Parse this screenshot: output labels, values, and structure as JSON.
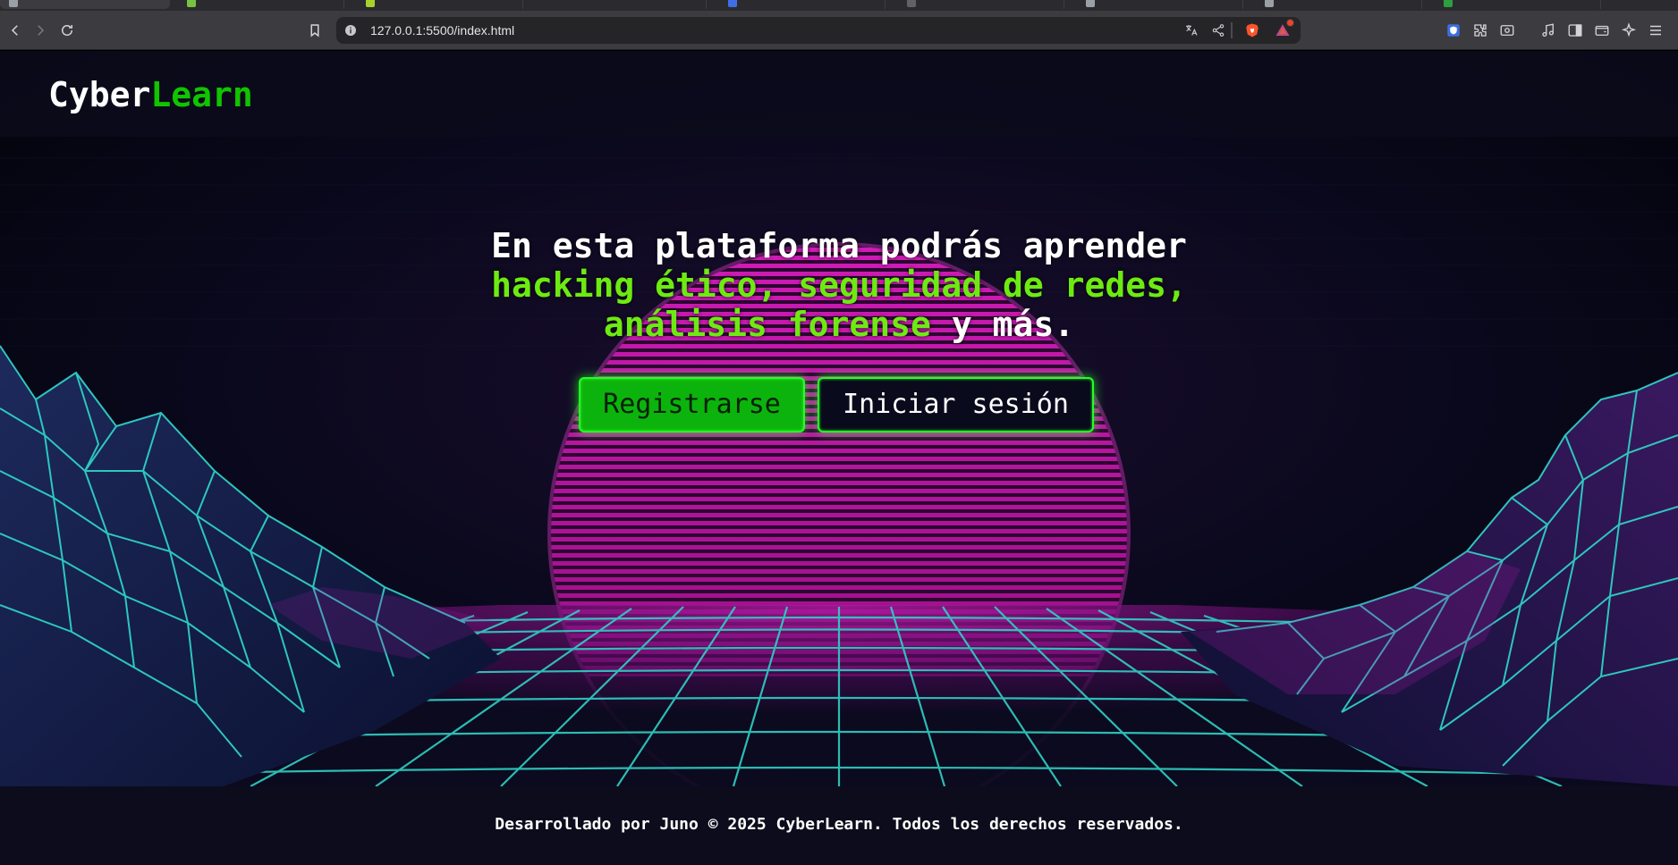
{
  "browser": {
    "url": "127.0.0.1:5500/index.html",
    "tab_favicon_colors": [
      "#9aa0a6",
      "#7ac142",
      "#a8d12a",
      "#3f6ee8",
      "#9aa0a6",
      "#9aa0a6",
      "#9aa0a6",
      "#2e9e3f"
    ],
    "icons": {
      "back": "arrow-left-icon",
      "forward": "arrow-right-icon",
      "reload": "reload-icon",
      "bookmark": "bookmark-icon",
      "site_info": "info-icon",
      "translate": "translate-icon",
      "share": "share-icon",
      "brave_shield": "brave-lion-icon",
      "rewards": "triangle-rewards-icon",
      "extension_1": "shield-extension-icon",
      "extensions": "puzzle-icon",
      "screenshot": "screenshot-icon",
      "media": "music-note-icon",
      "sidebar": "sidebar-icon",
      "wallet": "wallet-icon",
      "leo": "sparkle-icon",
      "menu": "hamburger-menu-icon"
    }
  },
  "site": {
    "logo_part1": "Cyber",
    "logo_part2": "Learn",
    "headline": {
      "line1": "En esta plataforma podrás aprender",
      "highlight1": "hacking ético, seguridad de redes,",
      "highlight2": "análisis forense",
      "tail": " y más."
    },
    "buttons": {
      "register": "Registrarse",
      "login": "Iniciar sesión"
    },
    "footer": "Desarrollado por Juno © 2025 CyberLearn. Todos los derechos reservados.",
    "colors": {
      "accent_green": "#10c400",
      "headline_green": "#6dea12",
      "neon_border": "#23ff23",
      "sun_magenta": "#c4189e",
      "grid_cyan": "#22c4b8",
      "background": "#05050f"
    }
  }
}
